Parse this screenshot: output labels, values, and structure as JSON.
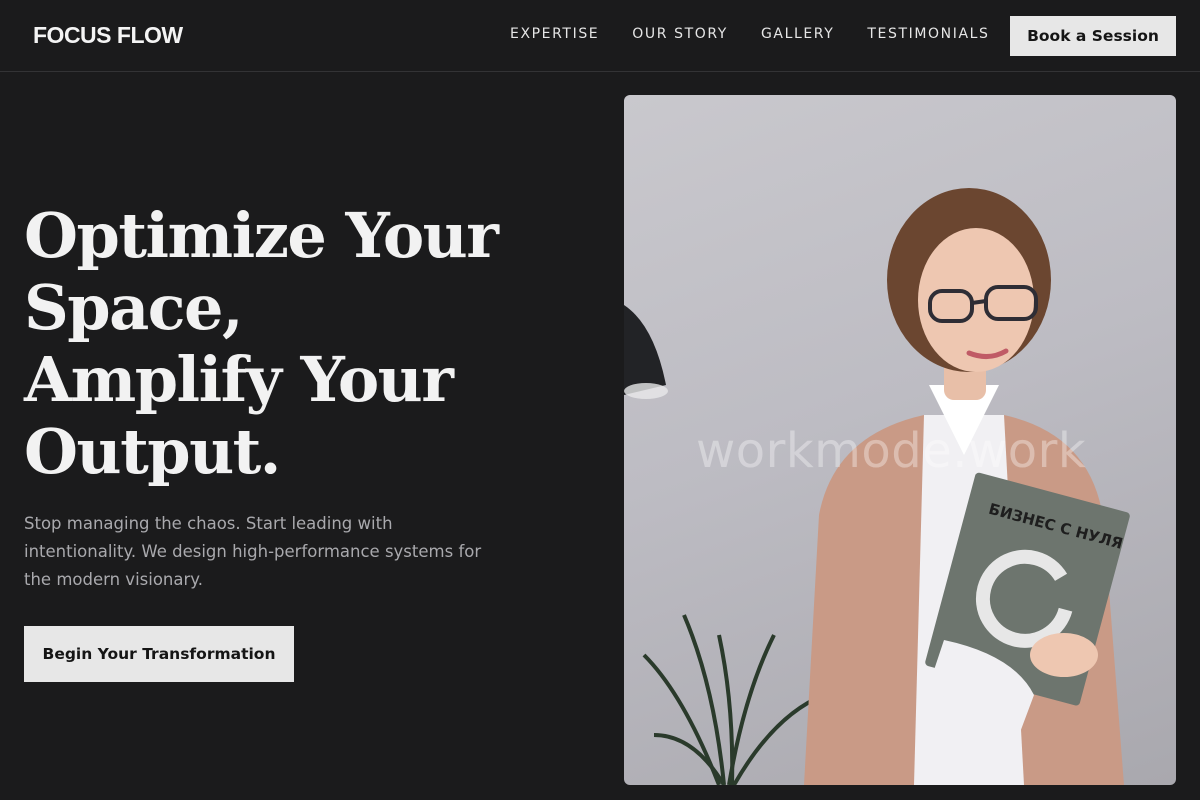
{
  "header": {
    "logo": "FOCUS FLOW",
    "nav": [
      "EXPERTISE",
      "OUR STORY",
      "GALLERY",
      "TESTIMONIALS"
    ],
    "cta": "Book a Session"
  },
  "hero": {
    "title_lines": [
      "Optimize Your",
      "Space,",
      "Amplify Your",
      "Output."
    ],
    "subtitle": "Stop managing the chaos. Start leading with intentionality. We design high-performance systems for the modern visionary.",
    "cta": "Begin Your Transformation"
  },
  "photo": {
    "watermark": "workmode.work",
    "book_title": "БИЗНЕС С НУЛЯ"
  },
  "colors": {
    "background": "#1b1b1c",
    "button_bg": "#e7e7e7",
    "text": "#f2f2f2",
    "muted_text": "#a9a9ad"
  }
}
